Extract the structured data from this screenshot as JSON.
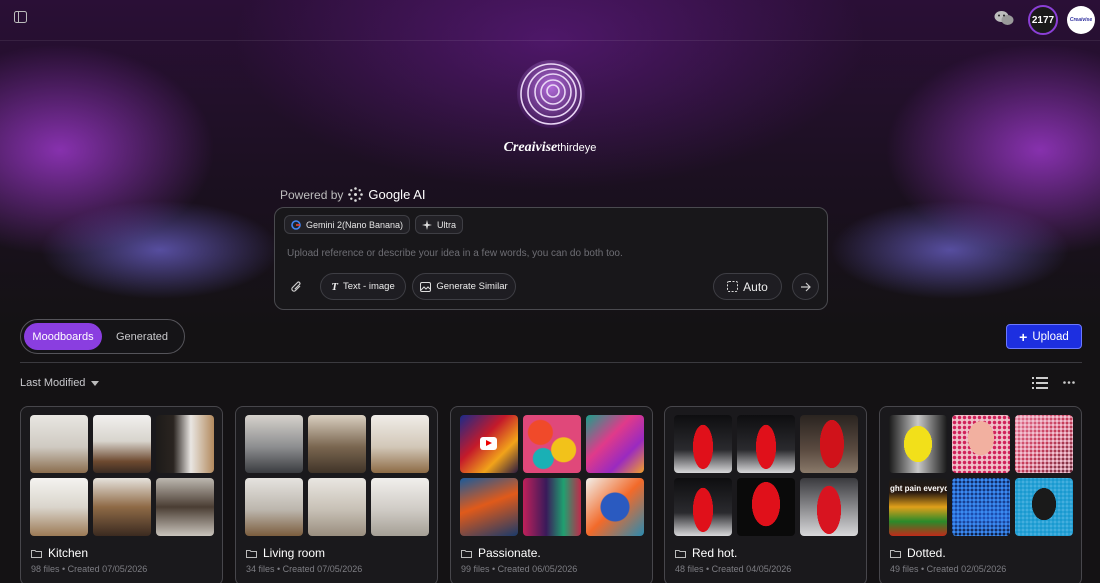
{
  "header": {
    "credits": "2177",
    "avatar_text": "Creaivise"
  },
  "brand": {
    "name_bold": "Creaivise",
    "name_light": "thirdeye"
  },
  "powered": {
    "prefix": "Powered by",
    "provider": "Google AI"
  },
  "prompt": {
    "model_chip": "Gemini 2(Nano Banana)",
    "quality_chip": "Ultra",
    "placeholder": "Upload reference or describe your idea in a few words, you can do both too.",
    "mode_text_image": "Text - image",
    "mode_similar": "Generate Similar",
    "aspect": "Auto"
  },
  "tabs": {
    "active": "Moodboards",
    "other": "Generated"
  },
  "upload_label": "Upload",
  "sort_label": "Last Modified",
  "colors": {
    "accent": "#8a3ee0",
    "upload": "#1d2fe0"
  },
  "boards": [
    {
      "title": "Kitchen",
      "meta": "98 files • Created 07/05/2026"
    },
    {
      "title": "Living room",
      "meta": "34 files • Created 07/05/2026"
    },
    {
      "title": "Passionate.",
      "meta": "99 files • Created 06/05/2026"
    },
    {
      "title": "Red hot.",
      "meta": "48 files • Created 04/05/2026"
    },
    {
      "title": "Dotted.",
      "meta": "49 files • Created 02/05/2026",
      "overlay": "ght pain everyd"
    }
  ]
}
